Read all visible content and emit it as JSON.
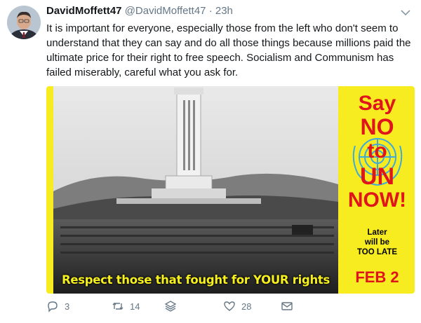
{
  "tweet": {
    "display_name": "DavidMoffett47",
    "handle": "@DavidMoffett47",
    "separator": "·",
    "time": "23h",
    "text": "It is important for everyone, especially those from the left who don't seem to understand that they can say and do all those things because millions paid the ultimate price for their right to free speech. Socialism and Communism has failed miserably, careful what you ask for.",
    "icons": {
      "more": "chevron-down-icon",
      "reply": "reply-icon",
      "retweet": "retweet-icon",
      "stack": "layers-icon",
      "like": "heart-icon",
      "dm": "envelope-icon"
    }
  },
  "media": {
    "caption": "Respect those that fought for YOUR rights",
    "side_lines": [
      "Say",
      "NO",
      "to",
      "UN",
      "NOW!"
    ],
    "note_lines": [
      "Later",
      "will be",
      "TOO LATE"
    ],
    "date": "FEB 2",
    "colors": {
      "background": "#f7ec1f",
      "red_text": "#e0141b",
      "caption_text": "#f6f01e",
      "un_logo": "#3fa9d9"
    }
  },
  "actions": {
    "reply_count": "3",
    "retweet_count": "14",
    "like_count": "28"
  },
  "theme": {
    "muted": "#657786",
    "text": "#14171a"
  }
}
